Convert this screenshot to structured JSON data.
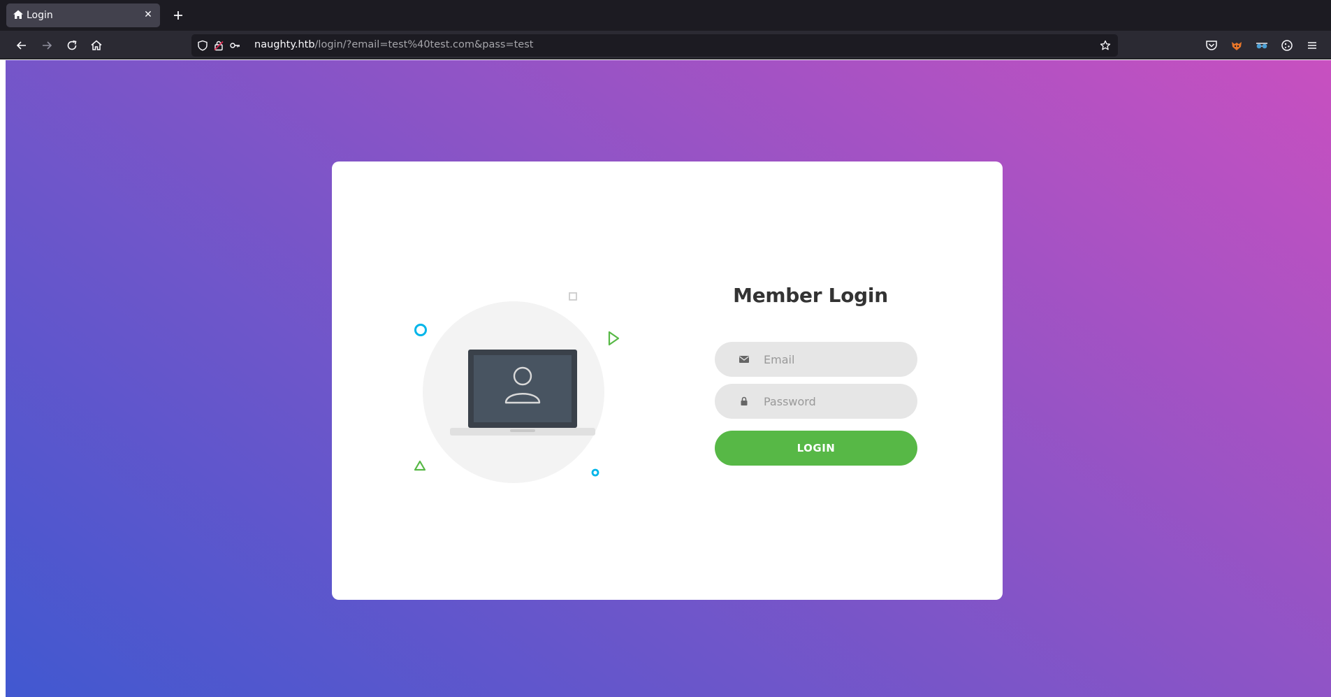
{
  "browser": {
    "tab": {
      "title": "Login",
      "icon": "home-icon"
    },
    "url": {
      "host": "naughty.htb",
      "path": "/login/?email=test%40test.com&pass=test"
    }
  },
  "login": {
    "title": "Member Login",
    "email_placeholder": "Email",
    "password_placeholder": "Password",
    "button_label": "LOGIN"
  },
  "colors": {
    "gradient_start": "#4158d0",
    "gradient_end": "#c850c0",
    "button": "#57b846",
    "accent_cyan": "#00b5e9",
    "accent_green": "#57b846"
  }
}
